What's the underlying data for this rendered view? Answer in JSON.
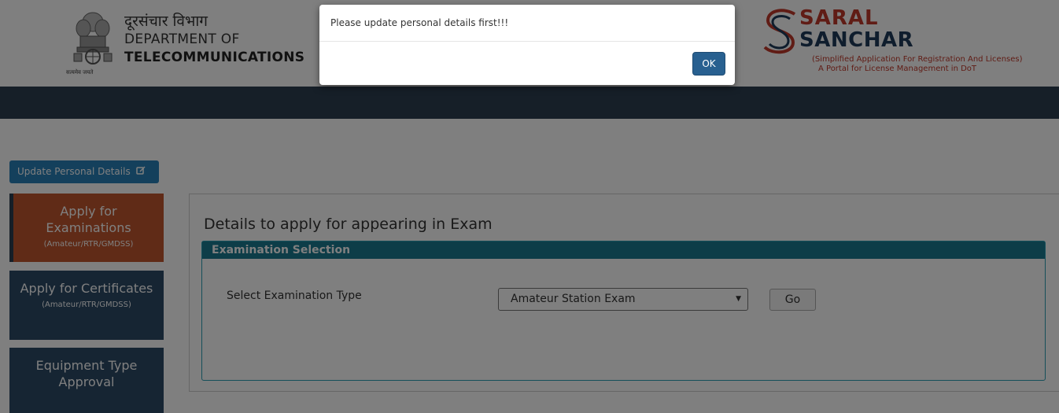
{
  "header": {
    "hindi_title": "दूरसंचार विभाग",
    "dept_line1": "DEPARTMENT OF",
    "dept_line2": "TELECOMMUNICATIONS",
    "emblem_caption": "सत्यमेव जयते",
    "saral_line1": "SARAL",
    "saral_line2": "SANCHAR",
    "saral_tagline1": "(Simplified Application For Registration And Licenses)",
    "saral_tagline2": "A Portal for License Management in DoT"
  },
  "update_button": {
    "label": "Update Personal Details",
    "icon": "edit-icon"
  },
  "sidebar": {
    "items": [
      {
        "title_line1": "Apply for",
        "title_line2": "Examinations",
        "sub": "(Amateur/RTR/GMDSS)",
        "active": true
      },
      {
        "title_line1": "Apply for Certificates",
        "sub": "(Amateur/RTR/GMDSS)",
        "active": false
      },
      {
        "title_line1": "Equipment Type",
        "title_line2": "Approval",
        "active": false
      }
    ]
  },
  "main": {
    "title": "Details to apply for appearing in Exam",
    "section_heading": "Examination Selection",
    "select_label": "Select Examination Type",
    "selected_exam": "Amateur Station Exam",
    "go_label": "Go"
  },
  "modal": {
    "message": "Please update personal details first!!!",
    "ok_label": "OK"
  },
  "colors": {
    "navbar": "#2c3e50",
    "active_menu": "#c0572f",
    "menu": "#2c4a66",
    "update_button": "#2980b9",
    "section_header": "#1a7a91",
    "ok_button": "#286090",
    "saral_red": "#c0392b",
    "saral_blue": "#1f3a5a"
  }
}
